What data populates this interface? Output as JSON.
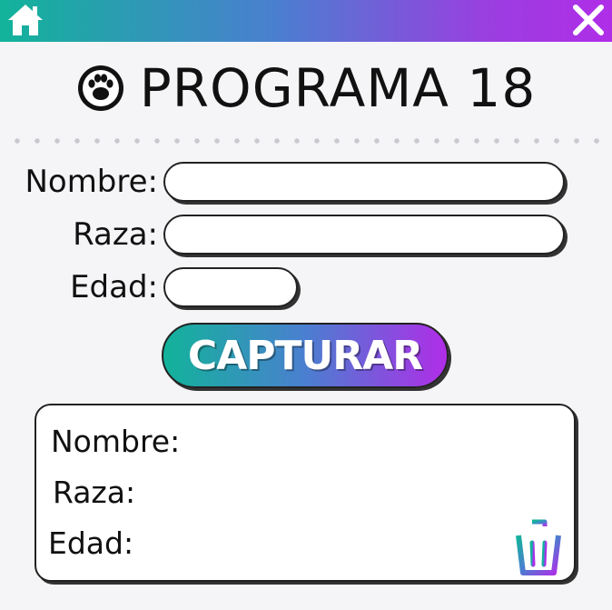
{
  "header": {
    "home_icon": "home-icon",
    "close_icon": "close-icon"
  },
  "title": {
    "icon": "paw-icon",
    "text": "PROGRAMA 18"
  },
  "form": {
    "nombre_label": "Nombre:",
    "raza_label": "Raza:",
    "edad_label": "Edad:",
    "nombre_value": "",
    "raza_value": "",
    "edad_value": ""
  },
  "capture_button": "CAPTURAR",
  "result": {
    "nombre_label": "Nombre:",
    "raza_label": "Raza:",
    "edad_label": "Edad:",
    "trash_icon": "trash-icon"
  },
  "colors": {
    "gradient_start": "#12b39a",
    "gradient_mid": "#4a7fd0",
    "gradient_end": "#b02de8"
  }
}
